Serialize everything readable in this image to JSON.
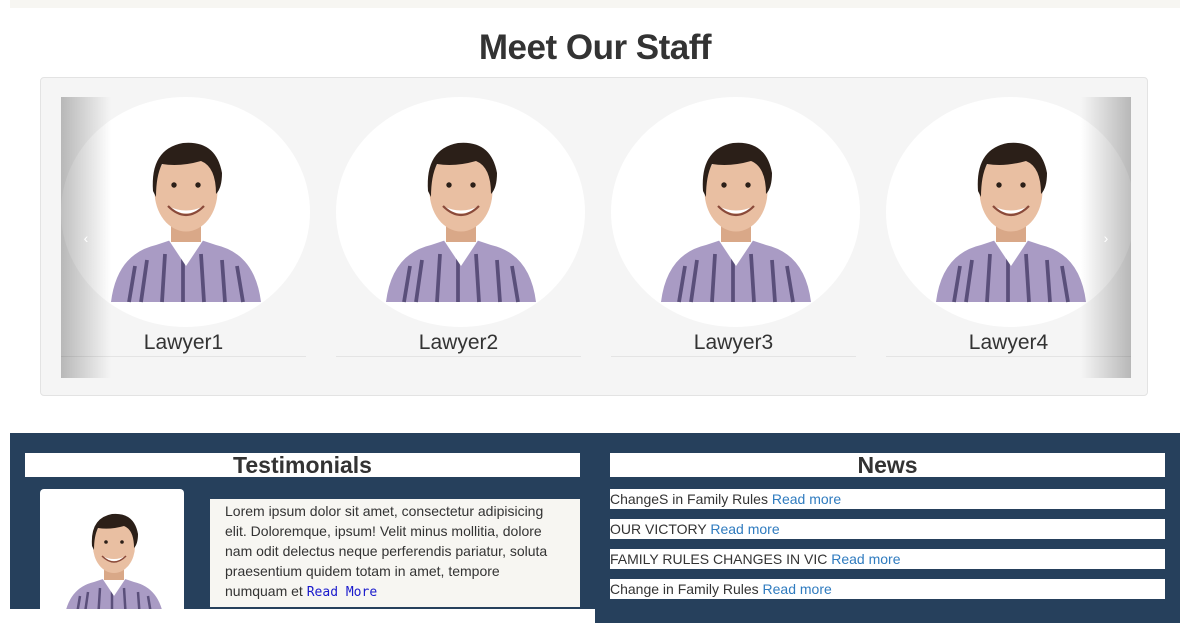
{
  "section_title": "Meet Our Staff",
  "carousel": {
    "prev_glyph": "‹",
    "next_glyph": "›",
    "staff": [
      {
        "name": "Lawyer1"
      },
      {
        "name": "Lawyer2"
      },
      {
        "name": "Lawyer3"
      },
      {
        "name": "Lawyer4"
      }
    ]
  },
  "testimonials": {
    "heading": "Testimonials",
    "text": "Lorem ipsum dolor sit amet, consectetur adipisicing elit. Doloremque, ipsum! Velit minus mollitia, dolore nam odit delectus neque perferendis pariatur, soluta praesentium quidem totam in amet, tempore numquam et",
    "link": "Read More"
  },
  "news": {
    "heading": "News",
    "items": [
      {
        "text": "ChangeS in Family Rules",
        "link": "Read more"
      },
      {
        "text": "OUR VICTORY",
        "link": "Read more"
      },
      {
        "text": "FAMILY RULES CHANGES IN VIC",
        "link": "Read more"
      },
      {
        "text": "Change in Family Rules",
        "link": "Read more"
      }
    ]
  },
  "colors": {
    "footer_bg": "#26405c",
    "link": "#2f7bbf",
    "panel_bg": "#f5f5f5"
  }
}
